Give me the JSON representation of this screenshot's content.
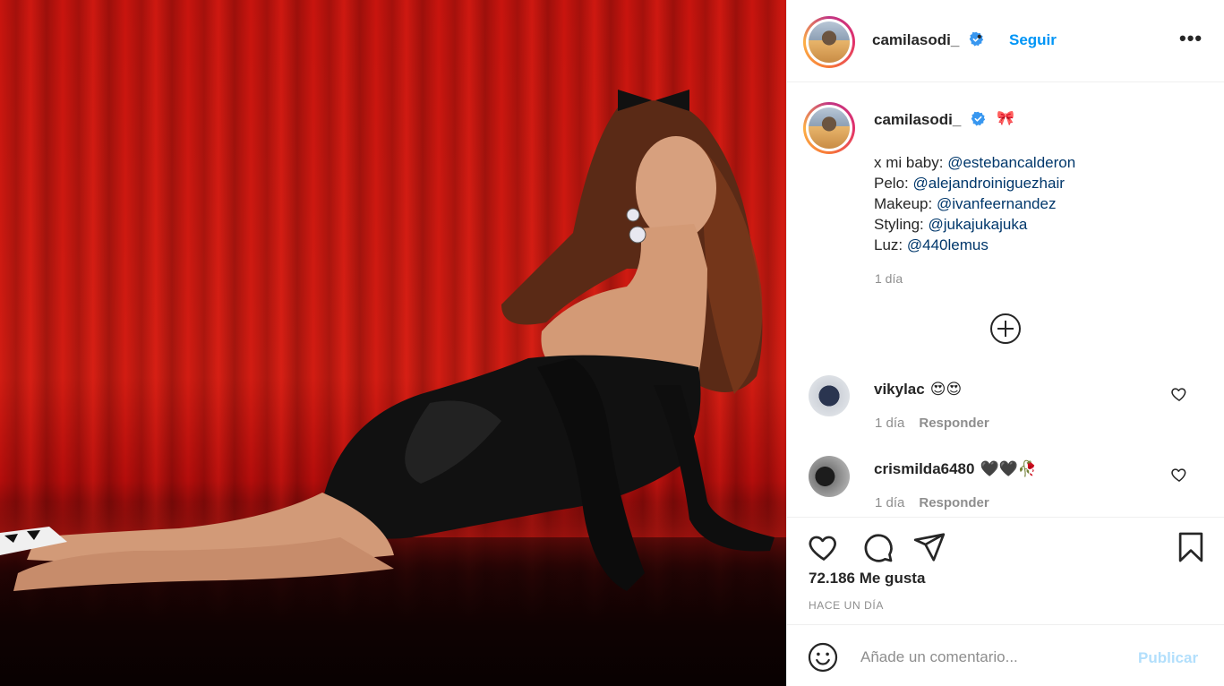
{
  "post": {
    "image_alt": "",
    "header": {
      "username": "camilasodi_",
      "separator": "•",
      "follow_label": "Seguir",
      "more_label": "•••"
    },
    "caption": {
      "username": "camilasodi_",
      "emoji": "🎀",
      "lines": [
        {
          "label": "x mi baby: ",
          "mention": "@estebancalderon"
        },
        {
          "label": "Pelo: ",
          "mention": "@alejandroiniguezhair"
        },
        {
          "label": "Makeup: ",
          "mention": "@ivanfeernandez"
        },
        {
          "label": "Styling: ",
          "mention": "@jukajukajuka"
        },
        {
          "label": "Luz: ",
          "mention": "@440lemus"
        }
      ],
      "time": "1 día"
    },
    "comments": [
      {
        "username": "vikylac",
        "text": "😍😍",
        "time": "1 día",
        "reply_label": "Responder"
      },
      {
        "username": "crismilda6480",
        "text": "🖤🖤🥀",
        "time": "1 día",
        "reply_label": "Responder"
      }
    ],
    "likes": "72.186 Me gusta",
    "posted": "HACE UN DÍA",
    "comment_box": {
      "placeholder": "Añade un comentario...",
      "publish_label": "Publicar"
    }
  },
  "icons": {
    "verified": "verified-badge-icon",
    "load_more": "plus-circle-icon",
    "like": "heart-icon",
    "comment": "comment-bubble-icon",
    "share": "paper-plane-icon",
    "save": "bookmark-icon",
    "emoji": "smiley-icon"
  },
  "colors": {
    "accent": "#0095f6",
    "mention": "#00376b",
    "muted": "#8e8e8e",
    "publish_disabled": "#b2dffc",
    "text": "#262626"
  }
}
